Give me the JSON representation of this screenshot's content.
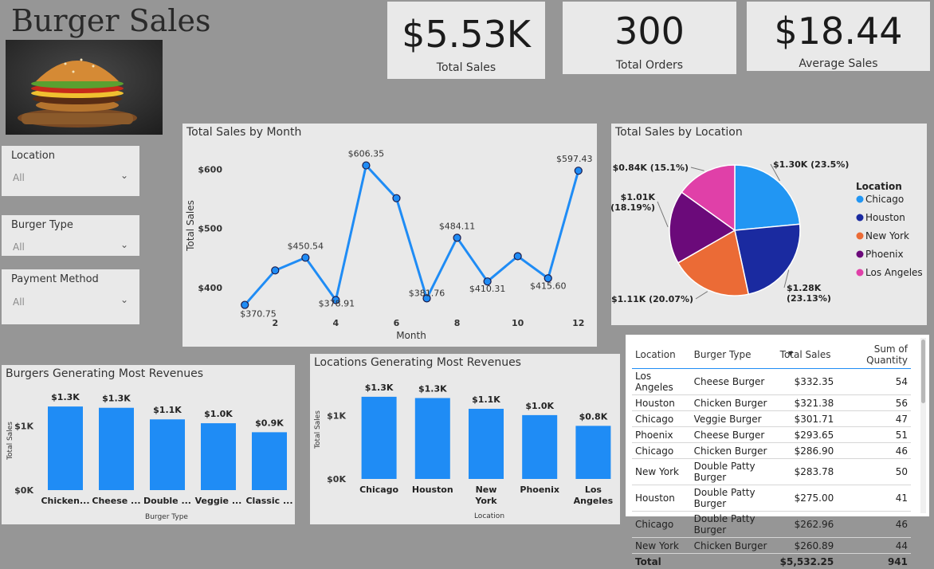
{
  "title": "Burger Sales",
  "kpis": [
    {
      "value": "$5.53K",
      "label": "Total Sales"
    },
    {
      "value": "300",
      "label": "Total Orders"
    },
    {
      "value": "$18.44",
      "label": "Average Sales"
    }
  ],
  "slicers": [
    {
      "label": "Location",
      "value": "All"
    },
    {
      "label": "Burger Type",
      "value": "All"
    },
    {
      "label": "Payment Method",
      "value": "All"
    }
  ],
  "colors": {
    "accent": "#1f8cf5",
    "chicago": "#2196f3",
    "houston": "#1a2aa0",
    "new_york": "#eb6b36",
    "phoenix": "#6b0a7a",
    "los_angeles": "#e040a8"
  },
  "chart_data": [
    {
      "type": "line",
      "title": "Total Sales by Month",
      "xlabel": "Month",
      "ylabel": "Total Sales",
      "x": [
        1,
        2,
        3,
        4,
        5,
        6,
        7,
        8,
        9,
        10,
        11,
        12
      ],
      "values": [
        370.75,
        429,
        450.54,
        378.91,
        606.35,
        551,
        381.76,
        484.11,
        410.31,
        453,
        415.6,
        597.43
      ],
      "point_labels": [
        "$370.75",
        "",
        "$450.54",
        "$378.91",
        "$606.35",
        "",
        "$381.76",
        "$484.11",
        "$410.31",
        "",
        "$415.60",
        "$597.43"
      ],
      "xticks": [
        2,
        4,
        6,
        8,
        10,
        12
      ],
      "yticks": [
        "$400",
        "$500",
        "$600"
      ],
      "ytick_values": [
        400,
        500,
        600
      ],
      "ylim": [
        350,
        630
      ],
      "xlim": [
        0.6,
        12.4
      ]
    },
    {
      "type": "pie",
      "title": "Total Sales by Location",
      "legend_title": "Location",
      "legend_position": "right",
      "slices": [
        {
          "name": "Chicago",
          "value": 1300,
          "share": 23.5,
          "label": "$1.30K (23.5%)",
          "color": "#2196f3"
        },
        {
          "name": "Houston",
          "value": 1280,
          "share": 23.13,
          "label": "$1.28K (23.13%)",
          "color": "#1a2aa0"
        },
        {
          "name": "New York",
          "value": 1110,
          "share": 20.07,
          "label": "$1.11K (20.07%)",
          "color": "#eb6b36"
        },
        {
          "name": "Phoenix",
          "value": 1010,
          "share": 18.19,
          "label": "$1.01K (18.19%)",
          "color": "#6b0a7a"
        },
        {
          "name": "Los Angeles",
          "value": 840,
          "share": 15.1,
          "label": "$0.84K (15.1%)",
          "color": "#e040a8"
        }
      ]
    },
    {
      "type": "bar",
      "title": "Burgers Generating Most Revenues",
      "xlabel": "Burger Type",
      "ylabel": "Total Sales",
      "categories": [
        "Chicken...",
        "Cheese ...",
        "Double ...",
        "Veggie ...",
        "Classic ..."
      ],
      "values": [
        1.3,
        1.28,
        1.1,
        1.04,
        0.9
      ],
      "value_labels": [
        "$1.3K",
        "$1.3K",
        "$1.1K",
        "$1.0K",
        "$0.9K"
      ],
      "yticks": [
        "$0K",
        "$1K"
      ],
      "ytick_values": [
        0,
        1
      ],
      "ylim": [
        0,
        1.45
      ]
    },
    {
      "type": "bar",
      "title": "Locations Generating Most Revenues",
      "xlabel": "Location",
      "ylabel": "Total Sales",
      "categories": [
        "Chicago",
        "Houston",
        "New York",
        "Phoenix",
        "Los Angeles"
      ],
      "values": [
        1.3,
        1.28,
        1.11,
        1.01,
        0.84
      ],
      "value_labels": [
        "$1.3K",
        "$1.3K",
        "$1.1K",
        "$1.0K",
        "$0.8K"
      ],
      "yticks": [
        "$0K",
        "$1K"
      ],
      "ytick_values": [
        0,
        1
      ],
      "ylim": [
        0,
        1.45
      ]
    },
    {
      "type": "table",
      "columns": [
        "Location",
        "Burger Type",
        "Total Sales",
        "Sum of Quantity"
      ],
      "rows": [
        [
          "Los Angeles",
          "Cheese Burger",
          "$332.35",
          "54"
        ],
        [
          "Houston",
          "Chicken Burger",
          "$321.38",
          "56"
        ],
        [
          "Chicago",
          "Veggie Burger",
          "$301.71",
          "47"
        ],
        [
          "Phoenix",
          "Cheese Burger",
          "$293.65",
          "51"
        ],
        [
          "Chicago",
          "Chicken Burger",
          "$286.90",
          "46"
        ],
        [
          "New York",
          "Double Patty Burger",
          "$283.78",
          "50"
        ],
        [
          "Houston",
          "Double Patty Burger",
          "$275.00",
          "41"
        ],
        [
          "Chicago",
          "Double Patty Burger",
          "$262.96",
          "46"
        ],
        [
          "New York",
          "Chicken Burger",
          "$260.89",
          "44"
        ]
      ],
      "total": [
        "Total",
        "",
        "$5,532.25",
        "941"
      ]
    }
  ]
}
